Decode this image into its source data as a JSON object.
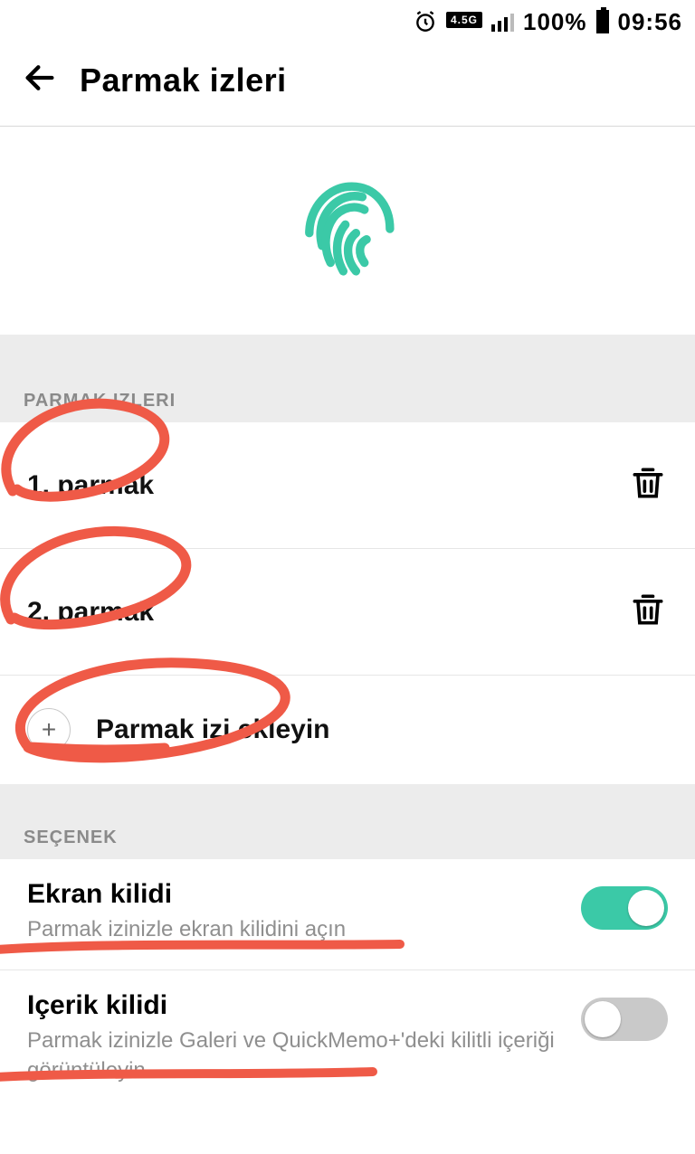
{
  "status": {
    "network_badge": "4.5G",
    "battery_pct": "100%",
    "time": "09:56"
  },
  "header": {
    "title": "Parmak izleri"
  },
  "sections": {
    "fingerprints": {
      "label": "PARMAK IZLERI",
      "items": [
        {
          "label": "1. parmak"
        },
        {
          "label": "2. parmak"
        }
      ],
      "add_label": "Parmak izi ekleyin"
    },
    "options": {
      "label": "SEÇENEK",
      "screen_lock": {
        "title": "Ekran kilidi",
        "subtitle": "Parmak izinizle ekran kilidini açın",
        "enabled": true
      },
      "content_lock": {
        "title": "Içerik kilidi",
        "subtitle": "Parmak izinizle Galeri ve QuickMemo+'deki kilitli içeriği görüntüleyin",
        "enabled": false
      }
    }
  },
  "colors": {
    "accent": "#3bc9a7",
    "annotation": "#ef5a47"
  }
}
